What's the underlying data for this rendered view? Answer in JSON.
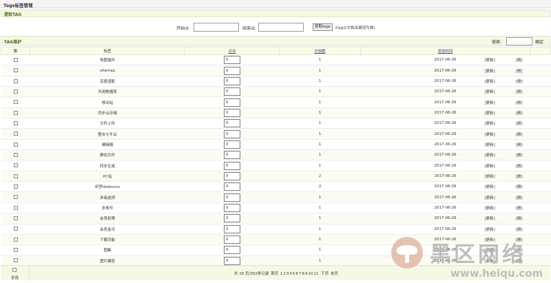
{
  "header": {
    "title": "Tags标签管理"
  },
  "fetch": {
    "title": "提取TAG",
    "start_label": "开始id:",
    "end_label": "结束id:",
    "button_label": "获取tags",
    "hint": "(tag以文档关键词为准)"
  },
  "manage": {
    "title": "TAG维护",
    "search_label": "搜索:",
    "search_button": "确定"
  },
  "table": {
    "columns": [
      "删",
      "标签",
      "点击",
      "文档数",
      "添加时间",
      ""
    ],
    "rows": [
      {
        "tag": "地图插件",
        "clicks": "0",
        "docs": "1",
        "date": "2017-06-26"
      },
      {
        "tag": "sitemap",
        "clicks": "0",
        "docs": "1",
        "date": "2017-06-26"
      },
      {
        "tag": "百度适配",
        "clicks": "0",
        "docs": "1",
        "date": "2017-06-26"
      },
      {
        "tag": "共用数据库",
        "clicks": "0",
        "docs": "1",
        "date": "2017-06-26"
      },
      {
        "tag": "移动站",
        "clicks": "0",
        "docs": "1",
        "date": "2017-06-26"
      },
      {
        "tag": "同步云存储",
        "clicks": "0",
        "docs": "1",
        "date": "2017-06-26"
      },
      {
        "tag": "文件上传",
        "clicks": "0",
        "docs": "1",
        "date": "2017-06-26"
      },
      {
        "tag": "整合七牛云",
        "clicks": "0",
        "docs": "1",
        "date": "2017-06-26"
      },
      {
        "tag": "编辑器",
        "clicks": "0",
        "docs": "1",
        "date": "2017-06-26"
      },
      {
        "tag": "静态文件",
        "clicks": "0",
        "docs": "1",
        "date": "2017-06-26"
      },
      {
        "tag": "同步生成",
        "clicks": "0",
        "docs": "1",
        "date": "2017-06-26"
      },
      {
        "tag": "PC站",
        "clicks": "0",
        "docs": "2",
        "date": "2017-06-26"
      },
      {
        "tag": "织梦dedecms",
        "clicks": "0",
        "docs": "2",
        "date": "2017-06-26"
      },
      {
        "tag": "多级选项",
        "clicks": "0",
        "docs": "1",
        "date": "2017-06-26"
      },
      {
        "tag": "多条件",
        "clicks": "0",
        "docs": "1",
        "date": "2017-06-26"
      },
      {
        "tag": "会员权限",
        "clicks": "0",
        "docs": "1",
        "date": "2017-06-26"
      },
      {
        "tag": "会员金币",
        "clicks": "0",
        "docs": "1",
        "date": "2017-06-26"
      },
      {
        "tag": "下载功能",
        "clicks": "0",
        "docs": "1",
        "date": "2017-06-26"
      },
      {
        "tag": "图集",
        "clicks": "0",
        "docs": "1",
        "date": "2017-06-26"
      },
      {
        "tag": "图片模型",
        "clicks": "0",
        "docs": "1",
        "date": "2017-06-26"
      }
    ],
    "update_label": "[更新]",
    "delete_label": "[删]"
  },
  "footer": {
    "select_all": "全选",
    "summary": "共 16 页/302条记录",
    "first": "首页",
    "pages": [
      "1",
      "2",
      "3",
      "4",
      "5",
      "6",
      "7",
      "8",
      "9",
      "10",
      "11"
    ],
    "next": "下页",
    "last": "末页"
  },
  "watermark": {
    "title": "黑区网络",
    "url": "www.heiqu.com",
    "logo_icon": "mushroom-logo-icon"
  }
}
